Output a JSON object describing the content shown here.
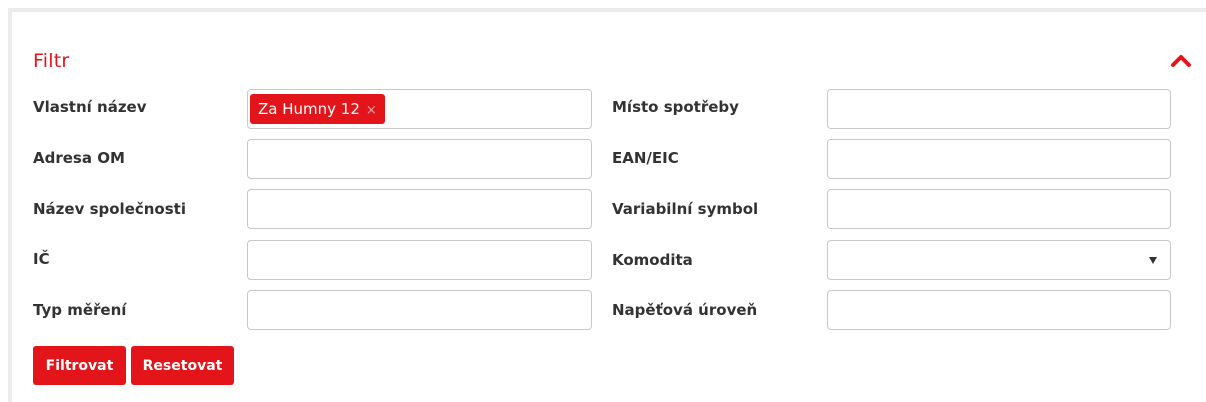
{
  "filter": {
    "title": "Filtr",
    "collapse_icon": "chevron-up-icon",
    "accent_color": "#e3151b",
    "fields": {
      "vlastni_nazev": {
        "label": "Vlastní název",
        "value": "",
        "tag": "Za Humny 12",
        "tag_remove": "×"
      },
      "misto_spotreby": {
        "label": "Místo spotřeby",
        "value": ""
      },
      "adresa_om": {
        "label": "Adresa OM",
        "value": ""
      },
      "ean_eic": {
        "label": "EAN/EIC",
        "value": ""
      },
      "nazev_spolecnosti": {
        "label": "Název společnosti",
        "value": ""
      },
      "variabilni_symbol": {
        "label": "Variabilní symbol",
        "value": ""
      },
      "ic": {
        "label": "IČ",
        "value": ""
      },
      "komodita": {
        "label": "Komodita",
        "value": ""
      },
      "typ_mereni": {
        "label": "Typ měření",
        "value": ""
      },
      "napetova_uroven": {
        "label": "Napěťová úroveň",
        "value": ""
      }
    },
    "buttons": {
      "filter_label": "Filtrovat",
      "reset_label": "Resetovat"
    }
  }
}
